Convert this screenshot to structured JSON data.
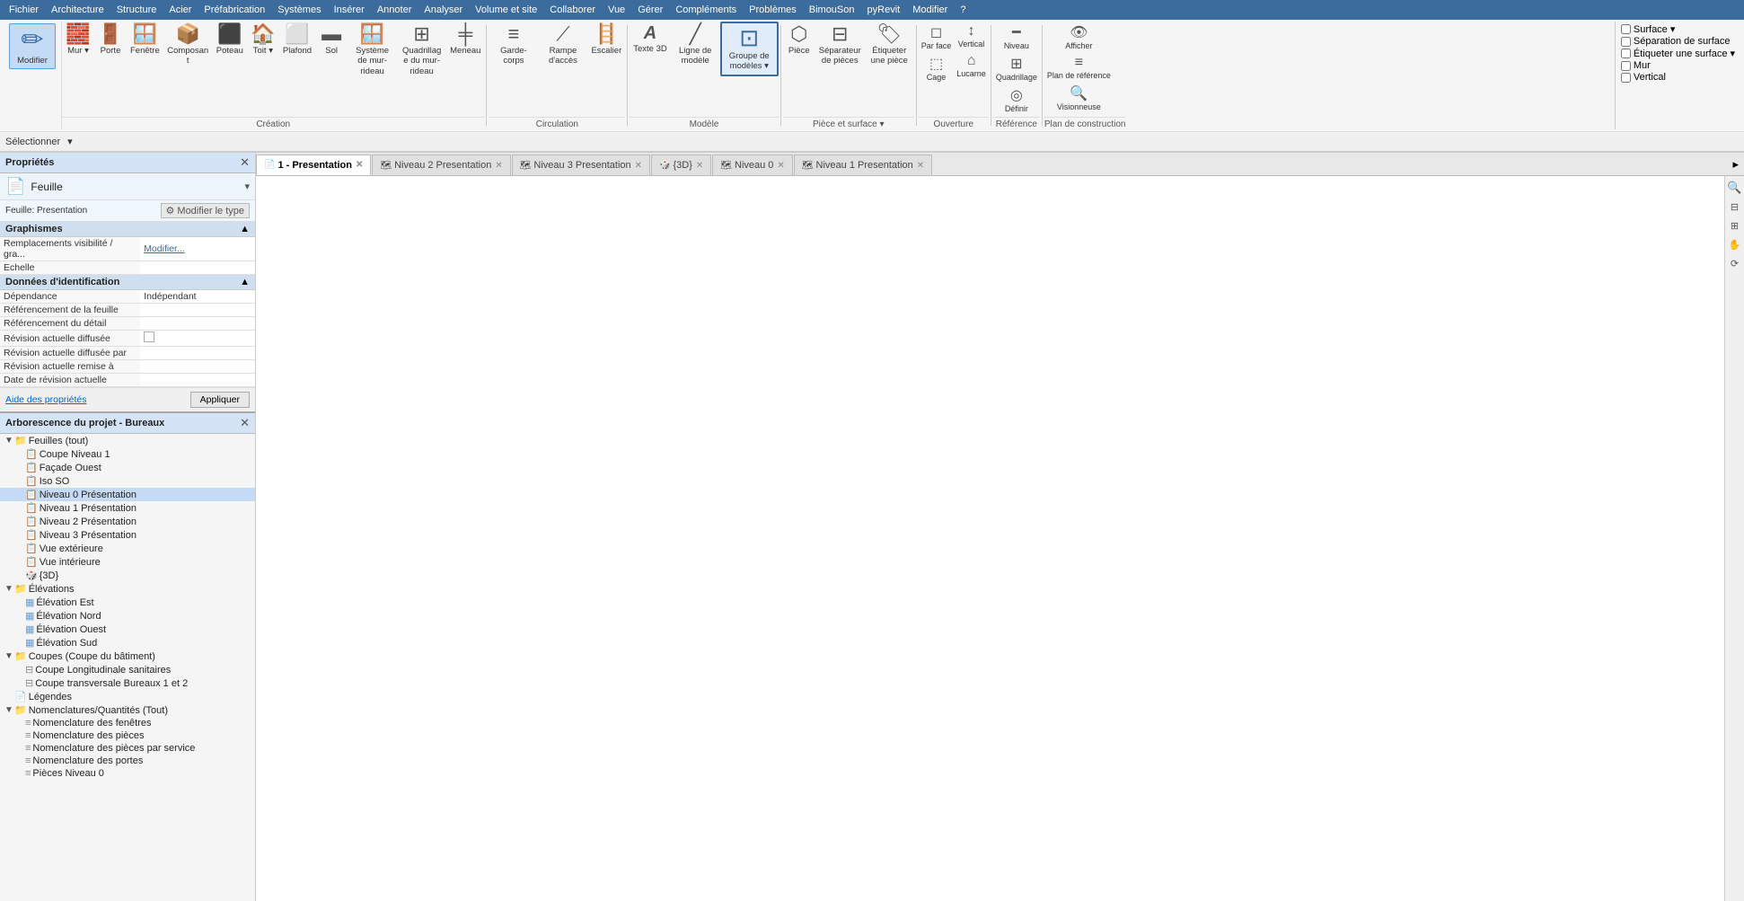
{
  "menu": {
    "items": [
      "Fichier",
      "Architecture",
      "Structure",
      "Acier",
      "Préfabrication",
      "Systèmes",
      "Insérer",
      "Annoter",
      "Analyser",
      "Volume et site",
      "Collaborer",
      "Vue",
      "Gérer",
      "Compléments",
      "Problèmes",
      "BimouSon",
      "pyRevit",
      "Modifier",
      "?"
    ]
  },
  "toolbar": {
    "groups": [
      {
        "name": "modifier-group",
        "label": "",
        "items": [
          {
            "id": "modifier-btn",
            "label": "Modifier",
            "icon": "✏️",
            "large": true,
            "active": true
          }
        ]
      },
      {
        "name": "creation-group",
        "label": "Création",
        "items": [
          {
            "id": "mur-btn",
            "label": "Mur",
            "icon": "🧱",
            "dropdown": true
          },
          {
            "id": "porte-btn",
            "label": "Porte",
            "icon": "🚪"
          },
          {
            "id": "fenetre-btn",
            "label": "Fenêtre",
            "icon": "🪟"
          },
          {
            "id": "composant-btn",
            "label": "Composant",
            "icon": "📦"
          },
          {
            "id": "poteau-btn",
            "label": "Poteau",
            "icon": "🔲"
          },
          {
            "id": "toit-btn",
            "label": "Toit",
            "icon": "🏠",
            "dropdown": true
          },
          {
            "id": "plafond-btn",
            "label": "Plafond",
            "icon": "⬜"
          },
          {
            "id": "sol-btn",
            "label": "Sol",
            "icon": "▭"
          },
          {
            "id": "systeme-mur-rideau-btn",
            "label": "Système de mur-rideau",
            "icon": "🪟"
          },
          {
            "id": "quadrillage-mur-rideau-btn",
            "label": "Quadrillage du mur-rideau",
            "icon": "⊞"
          },
          {
            "id": "meneau-btn",
            "label": "Meneau",
            "icon": "╪"
          }
        ]
      },
      {
        "name": "circulation-group",
        "label": "Circulation",
        "items": [
          {
            "id": "garde-corps-btn",
            "label": "Garde-corps",
            "icon": "≡"
          },
          {
            "id": "rampe-acces-btn",
            "label": "Rampe d'accès",
            "icon": "⟋"
          },
          {
            "id": "escalier-btn",
            "label": "Escalier",
            "icon": "🪜"
          }
        ]
      },
      {
        "name": "modele-group",
        "label": "Modèle",
        "items": [
          {
            "id": "texte-3d-btn",
            "label": "Texte 3D",
            "icon": "A"
          },
          {
            "id": "ligne-modele-btn",
            "label": "Ligne de modèle",
            "icon": "⟋"
          },
          {
            "id": "groupe-modeles-btn",
            "label": "Groupe de modèles",
            "icon": "⊡",
            "large": true,
            "dropdown": true
          }
        ]
      },
      {
        "name": "piece-surface-group",
        "label": "Pièce et surface",
        "items": [
          {
            "id": "piece-btn",
            "label": "Pièce",
            "icon": "⬡"
          },
          {
            "id": "separateur-pieces-btn",
            "label": "Séparateur de pièces",
            "icon": "---"
          },
          {
            "id": "etiqueter-piece-btn",
            "label": "Étiqueter une pièce",
            "icon": "🏷️"
          }
        ]
      },
      {
        "name": "ouverture-group",
        "label": "Ouverture",
        "items": [
          {
            "id": "par-face-btn",
            "label": "Par face",
            "icon": "◻"
          },
          {
            "id": "cage-btn",
            "label": "Cage",
            "icon": "⬚"
          },
          {
            "id": "vertical-btn",
            "label": "Vertical",
            "icon": "↕"
          },
          {
            "id": "lucarne-btn",
            "label": "Lucarne",
            "icon": "⌂"
          }
        ]
      },
      {
        "name": "reference-group",
        "label": "Référence",
        "items": [
          {
            "id": "niveau-btn",
            "label": "Niveau",
            "icon": "━"
          },
          {
            "id": "quadrillage-btn",
            "label": "Quadrillage",
            "icon": "⊞"
          },
          {
            "id": "definir-btn",
            "label": "Définir",
            "icon": "◎"
          }
        ]
      },
      {
        "name": "plan-construction-group",
        "label": "Plan de construction",
        "items": [
          {
            "id": "afficher-btn",
            "label": "Afficher",
            "icon": "👁️"
          },
          {
            "id": "plan-reference-btn",
            "label": "Plan de référence",
            "icon": "≡"
          },
          {
            "id": "visionneuse-btn",
            "label": "Visionneuse",
            "icon": "🔍"
          }
        ]
      }
    ],
    "right_panel": {
      "items": [
        {
          "id": "surface-btn",
          "label": "Surface",
          "icon": "⬚",
          "dropdown": true
        },
        {
          "id": "separation-surface-btn",
          "label": "Séparation de surface",
          "icon": "---"
        },
        {
          "id": "etiqueter-surface-btn",
          "label": "Étiqueter une surface",
          "icon": "🏷️",
          "dropdown": true
        },
        {
          "id": "mur-btn2",
          "label": "Mur",
          "icon": "🧱"
        },
        {
          "id": "vertical-btn2",
          "label": "Vertical",
          "icon": "↕"
        }
      ]
    }
  },
  "selector": {
    "label": "Sélectionner",
    "dropdown": "▾"
  },
  "properties_panel": {
    "title": "Propriétés",
    "type_icon": "📄",
    "type_name": "Feuille",
    "sheet_label": "Feuille: Presentation",
    "modify_type_label": "Modifier le type",
    "sections": [
      {
        "id": "graphismes",
        "title": "Graphismes",
        "rows": [
          {
            "label": "Remplacements visibilité / gra...",
            "value": "Modifier..."
          },
          {
            "label": "Echelle",
            "value": ""
          }
        ]
      },
      {
        "id": "identification",
        "title": "Données d'identification",
        "rows": [
          {
            "label": "Dépendance",
            "value": "Indépendant"
          },
          {
            "label": "Référencement de la feuille",
            "value": ""
          },
          {
            "label": "Référencement du détail",
            "value": ""
          },
          {
            "label": "Révision actuelle diffusée",
            "value": "checkbox"
          },
          {
            "label": "Révision actuelle diffusée par",
            "value": ""
          },
          {
            "label": "Révision actuelle remise à",
            "value": ""
          },
          {
            "label": "Date de révision actuelle",
            "value": ""
          }
        ]
      }
    ],
    "help_link": "Aide des propriétés",
    "apply_btn": "Appliquer"
  },
  "tree_panel": {
    "title": "Arborescence du projet - Bureaux",
    "items": [
      {
        "level": 0,
        "type": "folder",
        "label": "Feuilles (tout)",
        "expanded": true
      },
      {
        "level": 1,
        "type": "sheet",
        "label": "Coupe Niveau 1"
      },
      {
        "level": 1,
        "type": "sheet",
        "label": "Façade Ouest"
      },
      {
        "level": 1,
        "type": "sheet",
        "label": "Iso SO"
      },
      {
        "level": 1,
        "type": "sheet",
        "label": "Niveau 0 Présentation",
        "selected": true
      },
      {
        "level": 1,
        "type": "sheet",
        "label": "Niveau 1 Présentation"
      },
      {
        "level": 1,
        "type": "sheet",
        "label": "Niveau 2 Présentation"
      },
      {
        "level": 1,
        "type": "sheet",
        "label": "Niveau 3 Présentation"
      },
      {
        "level": 1,
        "type": "sheet",
        "label": "Vue extérieure"
      },
      {
        "level": 1,
        "type": "sheet",
        "label": "Vue intérieure"
      },
      {
        "level": 1,
        "type": "view3d",
        "label": "{3D}"
      },
      {
        "level": 0,
        "type": "folder",
        "label": "Élévations",
        "expanded": true
      },
      {
        "level": 1,
        "type": "elev",
        "label": "Élévation Est"
      },
      {
        "level": 1,
        "type": "elev",
        "label": "Élévation Nord"
      },
      {
        "level": 1,
        "type": "elev",
        "label": "Élévation Ouest"
      },
      {
        "level": 1,
        "type": "elev",
        "label": "Élévation Sud"
      },
      {
        "level": 0,
        "type": "folder",
        "label": "Coupes (Coupe du bâtiment)",
        "expanded": true
      },
      {
        "level": 1,
        "type": "section",
        "label": "Coupe Longitudinale sanitaires"
      },
      {
        "level": 1,
        "type": "section",
        "label": "Coupe transversale Bureaux 1 et 2"
      },
      {
        "level": 0,
        "type": "leaf",
        "label": "Légendes"
      },
      {
        "level": 0,
        "type": "folder",
        "label": "Nomenclatures/Quantités (Tout)",
        "expanded": true
      },
      {
        "level": 1,
        "type": "schedule",
        "label": "Nomenclature des fenêtres"
      },
      {
        "level": 1,
        "type": "schedule",
        "label": "Nomenclature des pièces"
      },
      {
        "level": 1,
        "type": "schedule",
        "label": "Nomenclature des pièces par service"
      },
      {
        "level": 1,
        "type": "schedule",
        "label": "Nomenclature des portes"
      },
      {
        "level": 1,
        "type": "schedule",
        "label": "Pièces Niveau 0"
      }
    ]
  },
  "tabs": [
    {
      "id": "presentation-tab",
      "label": "1 - Presentation",
      "active": true,
      "closeable": true
    },
    {
      "id": "niveau2-tab",
      "label": "Niveau 2 Presentation",
      "active": false,
      "closeable": true
    },
    {
      "id": "niveau3-tab",
      "label": "Niveau 3 Presentation",
      "active": false,
      "closeable": true
    },
    {
      "id": "3d-tab",
      "label": "{3D}",
      "active": false,
      "closeable": true
    },
    {
      "id": "niveau0-tab",
      "label": "Niveau 0",
      "active": false,
      "closeable": true
    },
    {
      "id": "niveau1-tab",
      "label": "Niveau 1 Presentation",
      "active": false,
      "closeable": true
    }
  ],
  "right_toolbar": {
    "buttons": [
      "🔍",
      "⊞",
      "↕",
      "↔",
      "⟳"
    ]
  },
  "colors": {
    "accent": "#3c6b9e",
    "tab_active": "#ffffff",
    "tab_inactive": "#e0e0e0",
    "panel_header": "#d4e3f5",
    "section_header": "#d0dff0",
    "ribbon_bg": "#f5f5f5",
    "menu_bg": "#3c6b9e"
  }
}
